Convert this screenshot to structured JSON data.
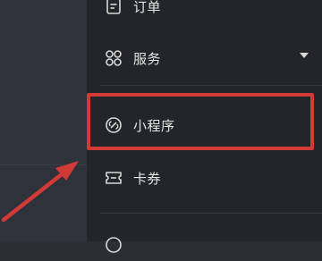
{
  "menu": {
    "items": [
      {
        "label": "订单",
        "icon": "document-icon"
      },
      {
        "label": "服务",
        "icon": "grid-icon",
        "has_dropdown": true
      },
      {
        "label": "小程序",
        "icon": "link-icon",
        "highlighted": true
      },
      {
        "label": "卡券",
        "icon": "ticket-icon"
      }
    ]
  },
  "annotation": {
    "color": "#d43a35"
  }
}
